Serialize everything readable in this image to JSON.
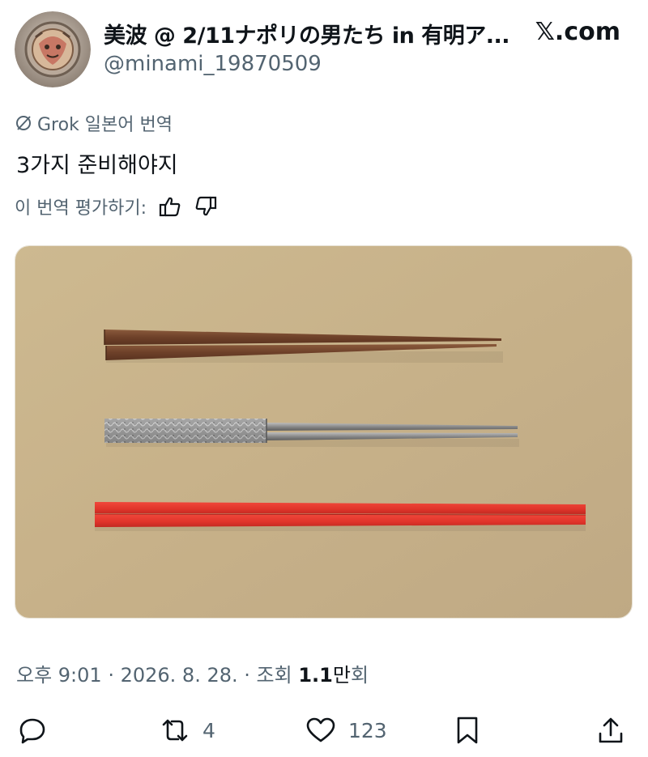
{
  "author": {
    "display_name": "美波 @ 2/11ナポリの男たち in 有明ア...",
    "handle": "@minami_19870509",
    "avatar_icon": "avatar-manhole-cover-icon"
  },
  "brand": {
    "label": "𝕏.com"
  },
  "translation": {
    "source_label": "Grok 일본어 번역",
    "rate_label": "이 번역 평가하기:"
  },
  "tweet": {
    "text": "3가지 준비해야지"
  },
  "meta": {
    "time": "오후 9:01",
    "date": "2026. 8. 28.",
    "views_prefix": "조회",
    "views_count": "1.1",
    "views_unit": "만",
    "views_suffix": "회"
  },
  "actions": {
    "reply_count": "",
    "retweet_count": "4",
    "like_count": "123",
    "bookmark_count": ""
  },
  "colors": {
    "text_primary": "#0f1419",
    "text_secondary": "#536471",
    "photo_background": "#c9b48d",
    "wooden_chopsticks": "#7a4a2e",
    "silver_chopsticks": "#8e8e8e",
    "red_chopsticks": "#e8392e"
  }
}
